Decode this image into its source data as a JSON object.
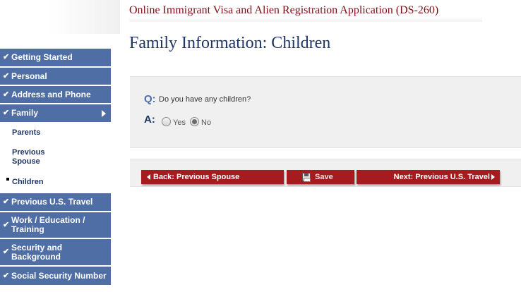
{
  "header": {
    "app_title": "Online Immigrant Visa and Alien Registration Application (DS-260)",
    "page_title": "Family Information: Children"
  },
  "sidebar": {
    "items": [
      {
        "label": "Getting Started",
        "checked": true
      },
      {
        "label": "Personal",
        "checked": true
      },
      {
        "label": "Address and Phone",
        "checked": true
      },
      {
        "label": "Family",
        "checked": true,
        "expanded": true
      },
      {
        "label": "Previous U.S. Travel",
        "checked": true
      },
      {
        "label": "Work / Education / Training",
        "checked": true
      },
      {
        "label": "Security and Background",
        "checked": true
      },
      {
        "label": "Social Security Number",
        "checked": true
      }
    ],
    "sub_items": [
      {
        "label": "Parents"
      },
      {
        "label": "Previous Spouse"
      },
      {
        "label": "Children",
        "current": true
      }
    ],
    "check_glyph": "✔"
  },
  "question": {
    "q_marker": "Q:",
    "text": "Do you have any children?",
    "a_marker": "A:",
    "options": [
      {
        "label": "Yes",
        "selected": false
      },
      {
        "label": "No",
        "selected": true
      }
    ]
  },
  "buttons": {
    "back_label": "Back: Previous Spouse",
    "save_label": "Save",
    "next_label": "Next: Previous U.S. Travel"
  },
  "colors": {
    "nav_bg": "#4e6ea5",
    "button_red": "#a71b20",
    "title_red": "#7a1016",
    "title_navy": "#1f3566"
  }
}
